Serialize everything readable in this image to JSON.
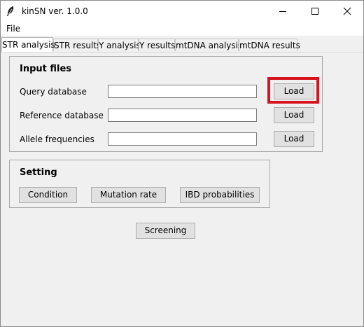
{
  "window": {
    "title": "kinSN ver. 1.0.0",
    "app_icon": "feather-icon",
    "controls": [
      "minimize-icon",
      "maximize-icon",
      "close-icon"
    ]
  },
  "menu": {
    "file_label": "File"
  },
  "tabs": [
    {
      "label": "STR analysis",
      "active": true
    },
    {
      "label": "STR results",
      "active": false
    },
    {
      "label": "Y analysis",
      "active": false
    },
    {
      "label": "Y results",
      "active": false
    },
    {
      "label": "mtDNA analysis",
      "active": false
    },
    {
      "label": "mtDNA results",
      "active": false
    }
  ],
  "input_files": {
    "title": "Input files",
    "rows": [
      {
        "label": "Query database",
        "value": "",
        "button": "Load"
      },
      {
        "label": "Reference database",
        "value": "",
        "button": "Load"
      },
      {
        "label": "Allele frequencies",
        "value": "",
        "button": "Load"
      }
    ]
  },
  "setting": {
    "title": "Setting",
    "buttons": [
      "Condition",
      "Mutation rate",
      "IBD probabilities"
    ]
  },
  "screening_label": "Screening",
  "colors": {
    "window_bg": "#f0f0f0",
    "titlebar_bg": "#ffffff",
    "highlight": "#d7141e"
  }
}
